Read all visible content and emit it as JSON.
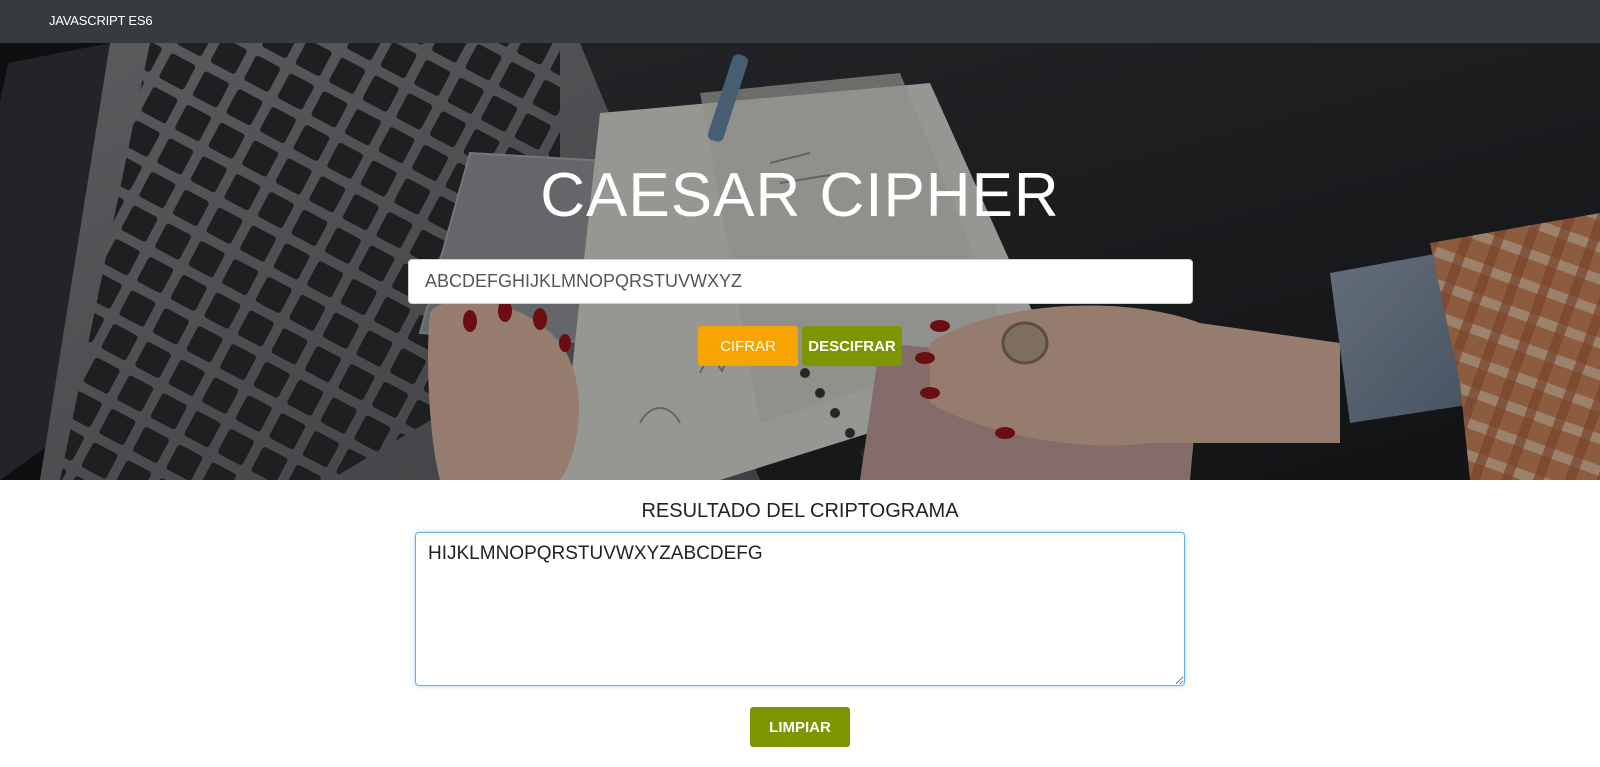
{
  "navbar": {
    "brand": "JAVASCRIPT ES6"
  },
  "hero": {
    "title": "CAESAR CIPHER",
    "input_value": "ABCDEFGHIJKLMNOPQRSTUVWXYZ",
    "cipher_button": "CIFRAR",
    "decipher_button": "DESCIFRAR"
  },
  "result": {
    "title": "RESULTADO DEL CRIPTOGRAMA",
    "value": "HIJKLMNOPQRSTUVWXYZABCDEFG",
    "clear_button": "LIMPIAR"
  },
  "colors": {
    "navbar": "#363b40",
    "cipher_button": "#f7a300",
    "decipher_button": "#7d9500",
    "clear_button": "#7d9500",
    "focus_border": "#66afe9"
  }
}
